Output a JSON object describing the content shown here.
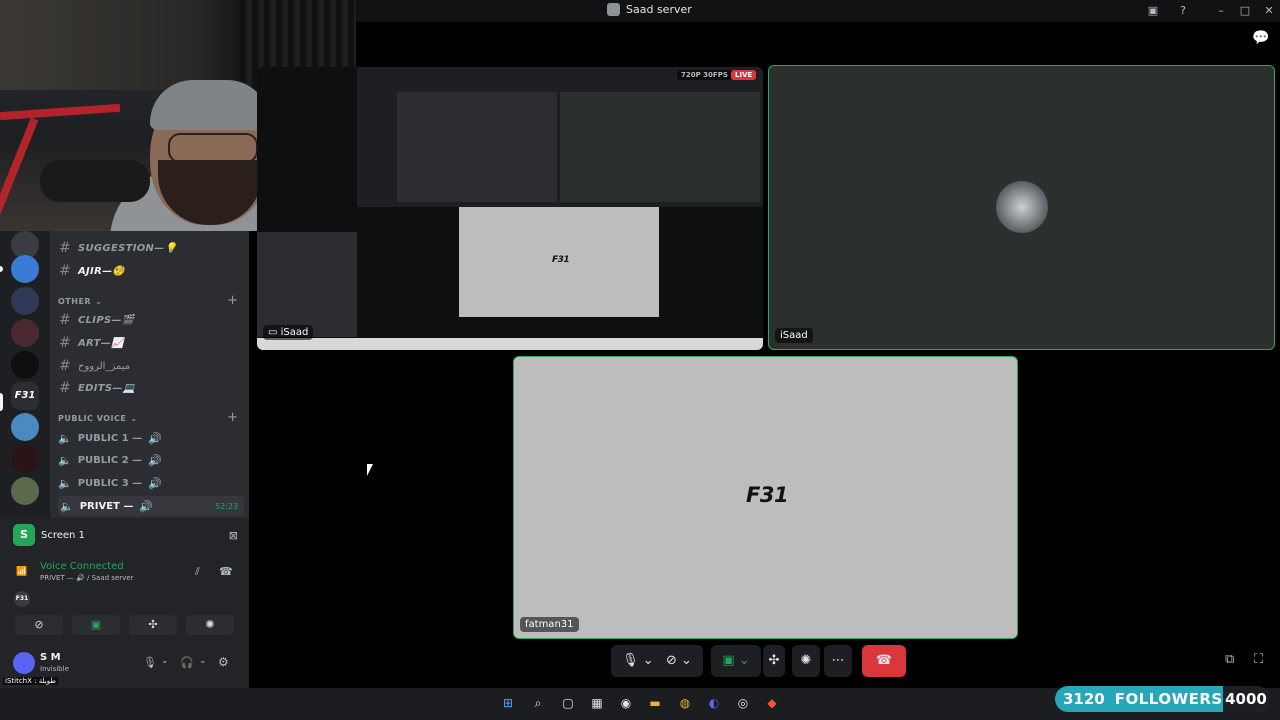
{
  "window": {
    "title": "Saad server"
  },
  "channels": {
    "items": [
      {
        "name": "SUGGESTION—💡",
        "type": "text"
      },
      {
        "name": "AJIR—🧐",
        "type": "text"
      }
    ],
    "category_other": "OTHER",
    "other_items": [
      {
        "name": "CLIPS—🎬"
      },
      {
        "name": "ART—📈"
      },
      {
        "name": "ميمز_الرووح"
      },
      {
        "name": "EDITS—💻"
      }
    ],
    "category_voice": "PUBLIC VOICE",
    "voice_items": [
      {
        "name": "PUBLIC 1 —"
      },
      {
        "name": "PUBLIC 2 —"
      },
      {
        "name": "PUBLIC 3 —"
      },
      {
        "name": "PRIVET —",
        "time": "52:23"
      }
    ]
  },
  "voice_panel": {
    "screen_label": "Screen 1",
    "status": "Voice Connected",
    "sub": "PRIVET — 🔊 / Saad server"
  },
  "user_panel": {
    "name": "S M",
    "status": "Invisible"
  },
  "tiles": {
    "a_label": "iSaad",
    "a_quality": "720P 30FPS",
    "a_live": "LIVE",
    "b_label": "iSaad",
    "c_label": "fatman31",
    "c_logo": "F31",
    "a_logo": "F31"
  },
  "followers": {
    "count": "3120",
    "label": "FOLLOWERS",
    "goal": "4000"
  },
  "chat": [
    {
      "text": "iStitchX : طويلة"
    }
  ],
  "colors": {
    "accent_green": "#23a55a",
    "hangup": "#da373c",
    "followers_bg": "#27a7b9"
  }
}
